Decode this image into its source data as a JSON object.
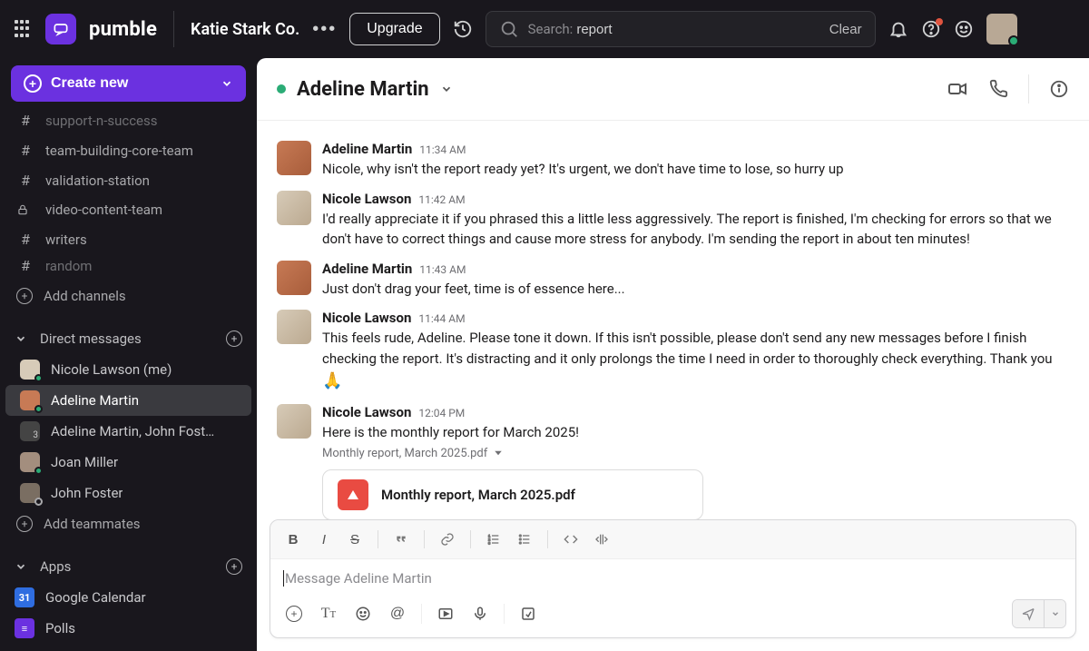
{
  "header": {
    "brand": "pumble",
    "workspace": "Katie Stark Co.",
    "upgrade": "Upgrade",
    "search_prefix": "Search: ",
    "search_query": "report",
    "clear": "Clear"
  },
  "sidebar": {
    "create_new": "Create new",
    "channels": [
      {
        "icon": "#",
        "label": "support-n-success",
        "faded": true
      },
      {
        "icon": "#",
        "label": "team-building-core-team"
      },
      {
        "icon": "#",
        "label": "validation-station"
      },
      {
        "icon": "lock",
        "label": "video-content-team"
      },
      {
        "icon": "#",
        "label": "writers"
      },
      {
        "icon": "#",
        "label": "random",
        "faded": true
      }
    ],
    "add_channels": "Add channels",
    "dm_header": "Direct messages",
    "dms": [
      {
        "label": "Nicole Lawson (me)",
        "avatar": "nicole",
        "presence": "online",
        "active": false
      },
      {
        "label": "Adeline Martin",
        "avatar": "adeline",
        "presence": "online",
        "active": true
      },
      {
        "label": "Adeline Martin, John Fost…",
        "avatar": "group",
        "group_count": "3"
      },
      {
        "label": "Joan Miller",
        "avatar": "joan",
        "presence": "online"
      },
      {
        "label": "John Foster",
        "avatar": "john",
        "presence": "away"
      }
    ],
    "add_teammates": "Add teammates",
    "apps_header": "Apps",
    "apps": [
      {
        "label": "Google Calendar",
        "icon": "cal",
        "badge": "31"
      },
      {
        "label": "Polls",
        "icon": "poll",
        "badge": "≡"
      }
    ]
  },
  "chat": {
    "title": "Adeline Martin",
    "messages": [
      {
        "author": "Adeline Martin",
        "avatar": "adeline",
        "time": "11:34 AM",
        "text": "Nicole, why isn't the report ready yet? It's urgent, we don't have time to lose, so hurry up"
      },
      {
        "author": "Nicole Lawson",
        "avatar": "nicole",
        "time": "11:42 AM",
        "text": "I'd really appreciate it if you phrased this a little less aggressively. The report is finished, I'm checking for errors so that we don't have to correct things and cause more stress for anybody. I'm sending the report in about ten minutes!"
      },
      {
        "author": "Adeline Martin",
        "avatar": "adeline",
        "time": "11:43 AM",
        "text": "Just don't drag your feet, time is of essence here..."
      },
      {
        "author": "Nicole Lawson",
        "avatar": "nicole",
        "time": "11:44 AM",
        "text": "This feels rude, Adeline. Please tone it down. If this isn't possible, please don't send any new messages before I finish checking the report. It's distracting and it only prolongs the time I need in order to thoroughly check everything. Thank you ",
        "emoji": "🙏"
      },
      {
        "author": "Nicole Lawson",
        "avatar": "nicole",
        "time": "12:04 PM",
        "text": "Here is the monthly report for March 2025!",
        "attachment": {
          "filename": "Monthly report, March 2025.pdf",
          "display": "Monthly report, March 2025.pdf"
        }
      }
    ],
    "composer_placeholder": "Message Adeline Martin"
  }
}
